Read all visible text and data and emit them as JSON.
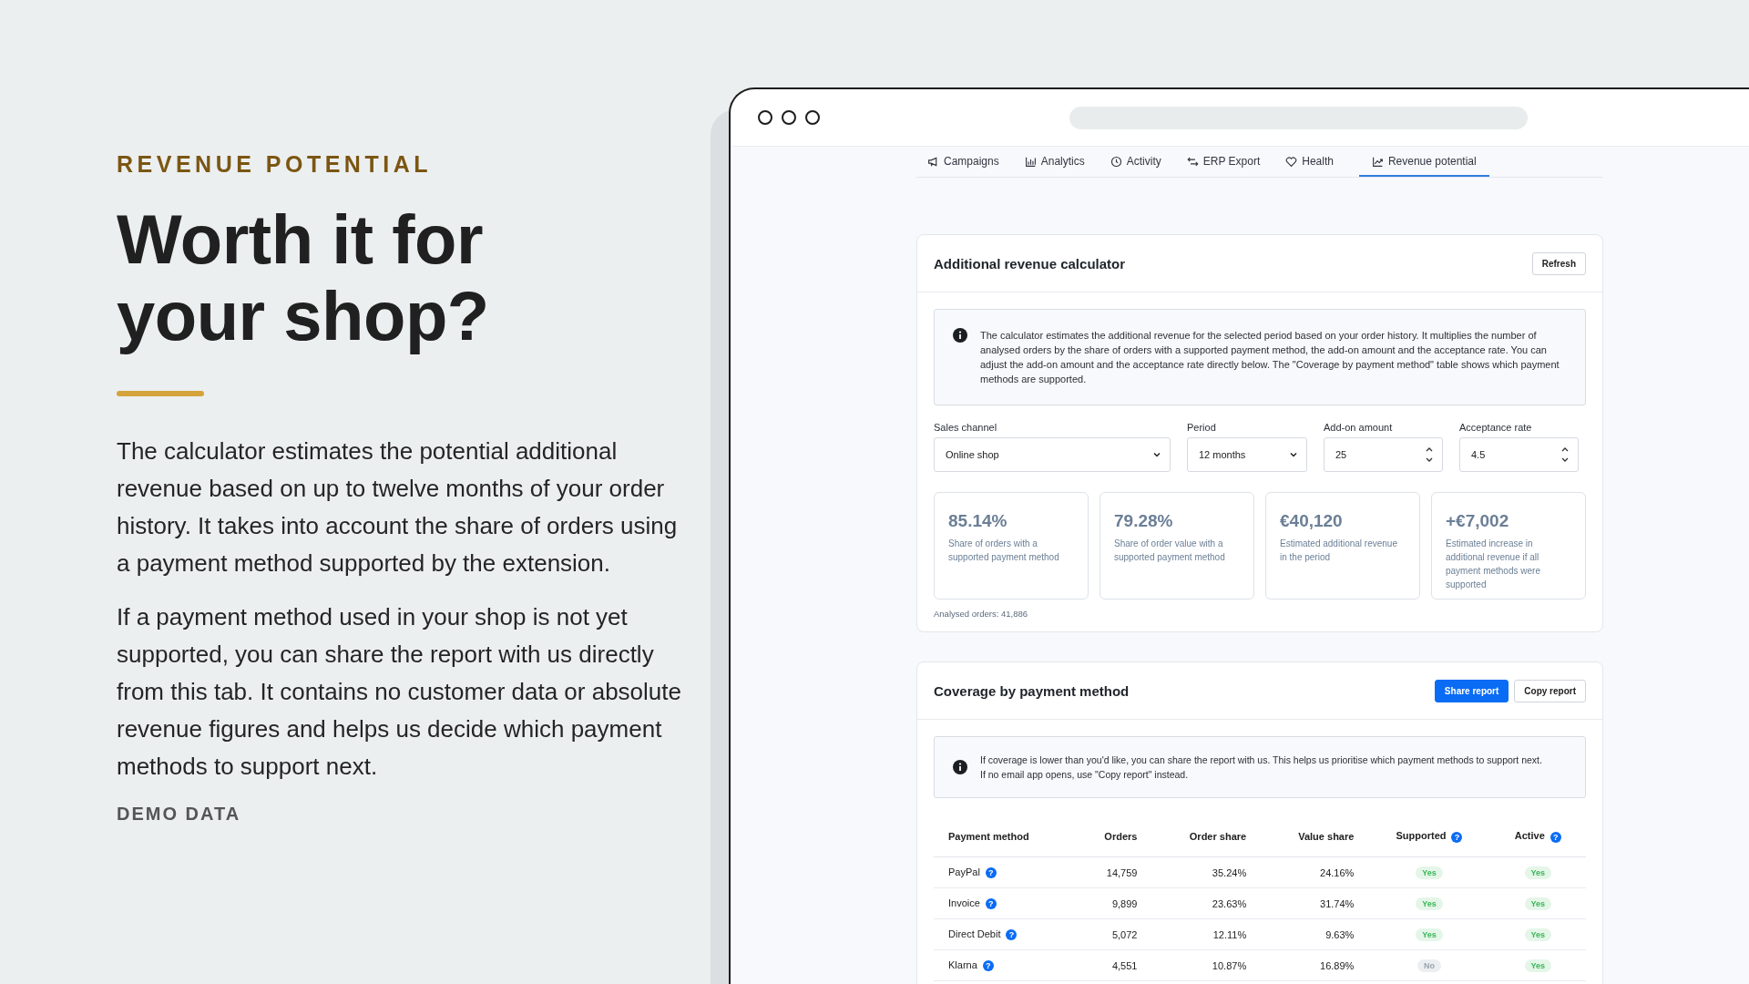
{
  "intro": {
    "eyebrow": "REVENUE POTENTIAL",
    "heading": "Worth it for your shop?",
    "paragraphs": [
      "The calculator estimates the potential additional revenue based on up to twelve months of your order history. It takes into account the share of orders using a payment method supported by the extension.",
      "If a payment method used in your shop is not yet supported, you can share the report with us directly from this tab. It contains no customer data or absolute revenue figures and helps us decide which payment methods to support next."
    ],
    "note": "DEMO DATA"
  },
  "tabs": [
    {
      "label": "Campaigns",
      "selected": false
    },
    {
      "label": "Analytics",
      "selected": false
    },
    {
      "label": "Activity",
      "selected": false
    },
    {
      "label": "ERP Export",
      "selected": false
    },
    {
      "label": "Health",
      "selected": false
    },
    {
      "label": "Revenue potential",
      "selected": true
    }
  ],
  "calculator": {
    "title": "Additional revenue calculator",
    "button": "Refresh",
    "info": "The calculator estimates the additional revenue for the selected period based on your order history. It multiplies the number of analysed orders by the share of orders with a supported payment method, the add-on amount and the acceptance rate. You can adjust the add-on amount and the acceptance rate directly below. The \"Coverage by payment method\" table shows which payment methods are supported.",
    "fields": [
      {
        "kind": "select",
        "label": "Sales channel",
        "value": "Online shop"
      },
      {
        "kind": "select",
        "label": "Period",
        "value": "12 months"
      },
      {
        "kind": "number",
        "label": "Add-on amount",
        "value": "25"
      },
      {
        "kind": "number",
        "label": "Acceptance rate",
        "value": "4.5"
      }
    ],
    "stats": [
      {
        "value": "85.14%",
        "label": "Share of orders with a supported payment method"
      },
      {
        "value": "79.28%",
        "label": "Share of order value with a supported payment method"
      },
      {
        "value": "€40,120",
        "label": "Estimated additional revenue in the period"
      },
      {
        "value": "+€7,002",
        "label": "Estimated increase in additional revenue if all payment methods were supported"
      }
    ],
    "analysed": "Analysed orders: 41,886"
  },
  "coverage": {
    "title": "Coverage by payment method",
    "buttons": [
      {
        "kind": "primary",
        "label": "Share report"
      },
      {
        "kind": "secondary",
        "label": "Copy report"
      }
    ],
    "info": [
      "If coverage is lower than you'd like, you can share the report with us. This helps us prioritise which payment methods to support next.",
      "If no email app opens, use \"Copy report\" instead."
    ],
    "columns": [
      {
        "label": "Payment method"
      },
      {
        "label": "Orders"
      },
      {
        "label": "Order share"
      },
      {
        "label": "Value share"
      },
      {
        "label": "Supported",
        "help": "?"
      },
      {
        "label": "Active",
        "help": "?"
      }
    ],
    "rows": [
      {
        "method": "PayPal",
        "help": "?",
        "orders": "14,759",
        "order_share": "35.24%",
        "value_share": "24.16%",
        "supported": {
          "label": "Yes",
          "positive": true
        },
        "active": {
          "label": "Yes",
          "positive": true
        }
      },
      {
        "method": "Invoice",
        "help": "?",
        "orders": "9,899",
        "order_share": "23.63%",
        "value_share": "31.74%",
        "supported": {
          "label": "Yes",
          "positive": true
        },
        "active": {
          "label": "Yes",
          "positive": true
        }
      },
      {
        "method": "Direct Debit",
        "help": "?",
        "orders": "5,072",
        "order_share": "12.11%",
        "value_share": "9.63%",
        "supported": {
          "label": "Yes",
          "positive": true
        },
        "active": {
          "label": "Yes",
          "positive": true
        }
      },
      {
        "method": "Klarna",
        "help": "?",
        "orders": "4,551",
        "order_share": "10.87%",
        "value_share": "16.89%",
        "supported": {
          "label": "No",
          "positive": false
        },
        "active": {
          "label": "Yes",
          "positive": true
        }
      }
    ]
  }
}
